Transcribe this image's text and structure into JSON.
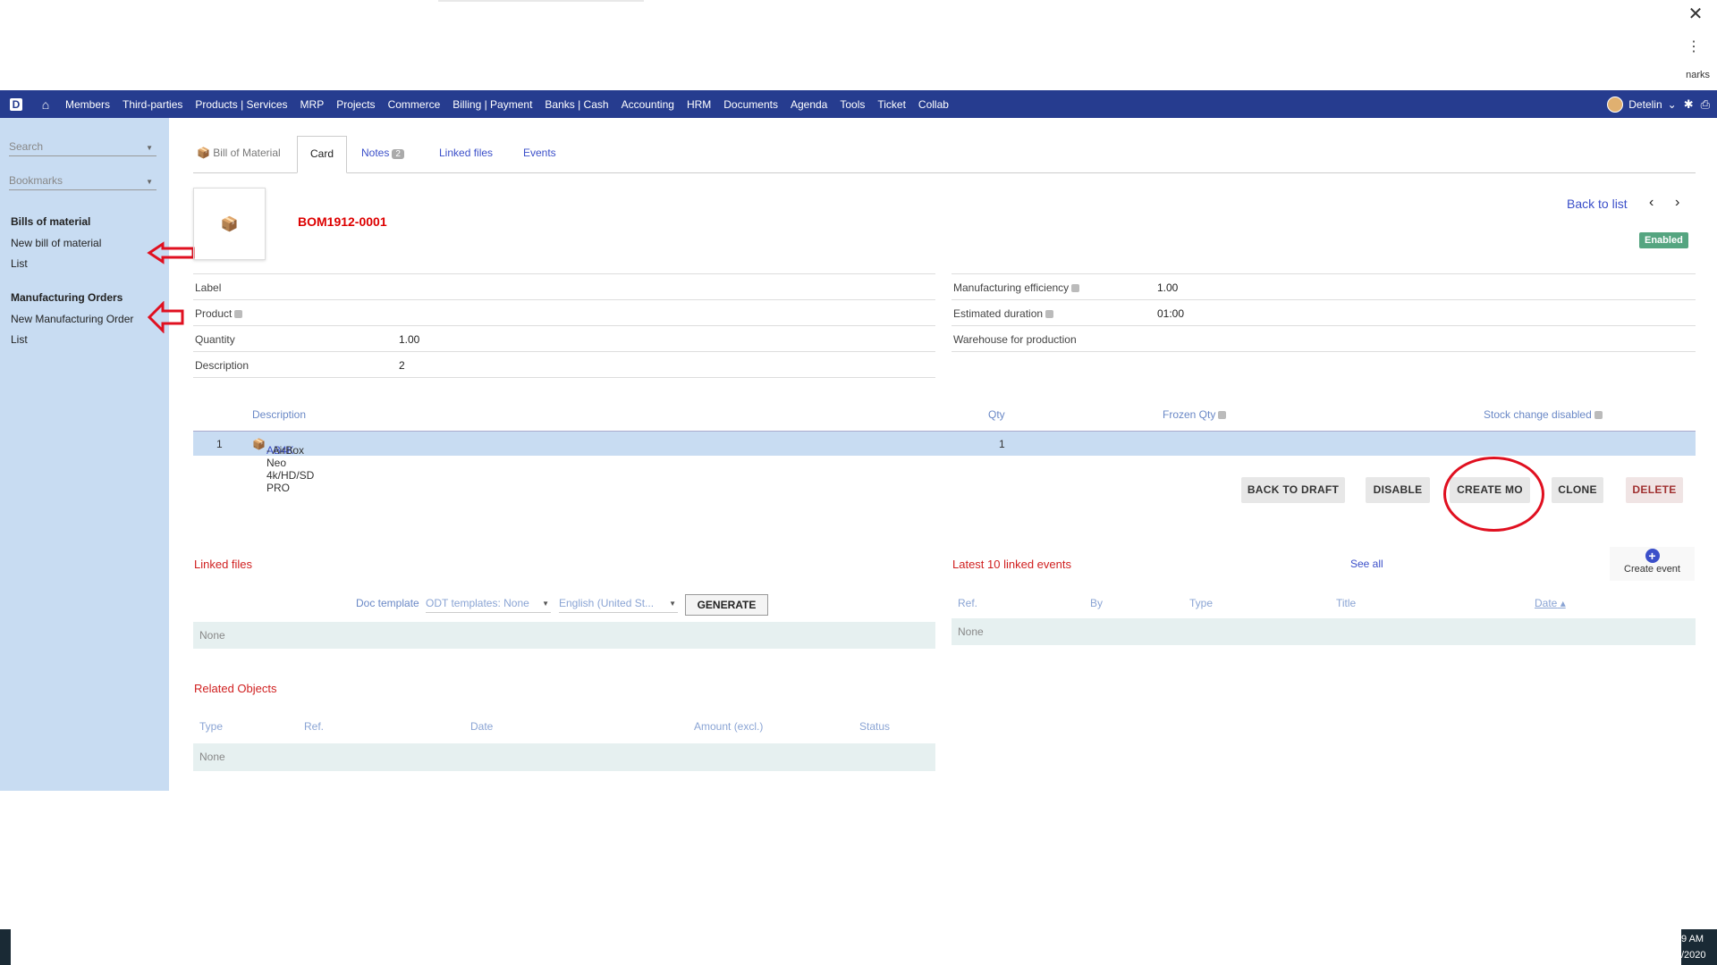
{
  "browser": {
    "bookmarks_fragment": "narks",
    "close_glyph": "✕",
    "menu_glyph": "⋮"
  },
  "topnav": {
    "logo": "D",
    "items": [
      "Members",
      "Third-parties",
      "Products | Services",
      "MRP",
      "Projects",
      "Commerce",
      "Billing | Payment",
      "Banks | Cash",
      "Accounting",
      "HRM",
      "Documents",
      "Agenda",
      "Tools",
      "Ticket",
      "Collab"
    ],
    "user": "Detelin",
    "accent": "#263c8f"
  },
  "sidebar": {
    "search_placeholder": "Search",
    "bookmarks_placeholder": "Bookmarks",
    "sections": [
      {
        "title": "Bills of material",
        "links": [
          "New bill of material",
          "List"
        ]
      },
      {
        "title": "Manufacturing Orders",
        "links": [
          "New Manufacturing Order",
          "List"
        ]
      }
    ]
  },
  "tabs": {
    "bom": "Bill of Material",
    "card": "Card",
    "notes": "Notes",
    "notes_count": "2",
    "linked_files": "Linked files",
    "events": "Events"
  },
  "record": {
    "ref": "BOM1912-0001",
    "back_to_list": "Back to list",
    "status": "Enabled"
  },
  "fields_left": [
    {
      "label": "Label",
      "value": ""
    },
    {
      "label": "Product",
      "value": ""
    },
    {
      "label": "Quantity",
      "value": "1.00"
    },
    {
      "label": "Description",
      "value": "2"
    }
  ],
  "fields_right": [
    {
      "label": "Manufacturing efficiency",
      "value": "1.00"
    },
    {
      "label": "Estimated duration",
      "value": "01:00"
    },
    {
      "label": "Warehouse for production",
      "value": ""
    }
  ],
  "lines": {
    "headers": {
      "description": "Description",
      "qty": "Qty",
      "frozen": "Frozen Qty",
      "stock": "Stock change disabled"
    },
    "rows": [
      {
        "num": "1",
        "ref": "AB4K",
        "label": " - AirBox Neo 4k/HD/SD PRO",
        "qty": "1"
      }
    ]
  },
  "actions": [
    "BACK TO DRAFT",
    "DISABLE",
    "CREATE MO",
    "CLONE",
    "DELETE"
  ],
  "linked_files": {
    "title": "Linked files",
    "doc_template_label": "Doc template",
    "template_select": "ODT templates: None",
    "lang_select": "English (United St...",
    "generate": "GENERATE",
    "none": "None"
  },
  "events": {
    "title": "Latest 10 linked events",
    "see_all": "See all",
    "create": "Create event",
    "headers": [
      "Ref.",
      "By",
      "Type",
      "Title",
      "Date"
    ],
    "none": "None"
  },
  "related": {
    "title": "Related Objects",
    "headers": [
      "Type",
      "Ref.",
      "Date",
      "Amount (excl.)",
      "Status"
    ],
    "none": "None"
  },
  "taskbar": {
    "time": "9 AM",
    "date": "/2020"
  }
}
